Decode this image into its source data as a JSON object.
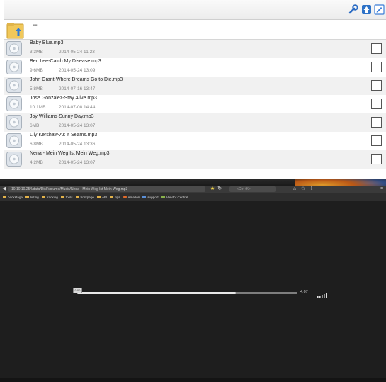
{
  "toolbar": {
    "buttons": [
      {
        "name": "wrench-icon",
        "label": "settings"
      },
      {
        "name": "upload-icon",
        "label": "upload"
      },
      {
        "name": "edit-icon",
        "label": "edit"
      }
    ]
  },
  "up_row": {
    "label": "--"
  },
  "files": [
    {
      "name": "Baby Blue.mp3",
      "size": "3.3MB",
      "date": "2014-05-24 11:23"
    },
    {
      "name": "Ben Lee-Catch My Disease.mp3",
      "size": "9.6MB",
      "date": "2014-05-24 13:09"
    },
    {
      "name": "John Grant-Where Dreams Go to Die.mp3",
      "size": "5.8MB",
      "date": "2014-07-16 13:47"
    },
    {
      "name": "Jose Gonzalez-Stay Alive.mp3",
      "size": "10.1MB",
      "date": "2014-07-08 14:44"
    },
    {
      "name": "Joy Williams-Sunny Day.mp3",
      "size": "6MB",
      "date": "2014-05-24 13:07"
    },
    {
      "name": "Lily Kershaw-As It Seams.mp3",
      "size": "6.8MB",
      "date": "2014-05-24 13:36"
    },
    {
      "name": "Nena - Mein Weg Ist Mein Weg.mp3",
      "size": "4.2MB",
      "date": "2014-05-24 13:07"
    }
  ],
  "browser": {
    "url": "10.10.10.254/data/DiskVolume/Music/Nena - Mein Weg Ist Mein Weg.mp3",
    "search_placeholder": "<Ctrl+K>",
    "bookmarks": [
      {
        "label": "backstage",
        "icon": "folder"
      },
      {
        "label": "listing",
        "icon": "folder"
      },
      {
        "label": "tracking",
        "icon": "folder"
      },
      {
        "label": "tools",
        "icon": "folder"
      },
      {
        "label": "frontpage",
        "icon": "folder"
      },
      {
        "label": "API",
        "icon": "folder"
      },
      {
        "label": "tips",
        "icon": "folder"
      },
      {
        "label": "Amazon",
        "icon": "amazon"
      },
      {
        "label": "support",
        "icon": "support"
      },
      {
        "label": "Vendor Central",
        "icon": "vendor"
      }
    ]
  },
  "player": {
    "thumb_label": "0:00",
    "time": "4:07",
    "progress": 0.72
  },
  "colors": {
    "page_bg": "#ffffff",
    "row_alt_bg": "#f1f1f1",
    "player_bg": "#1e1e1e"
  }
}
